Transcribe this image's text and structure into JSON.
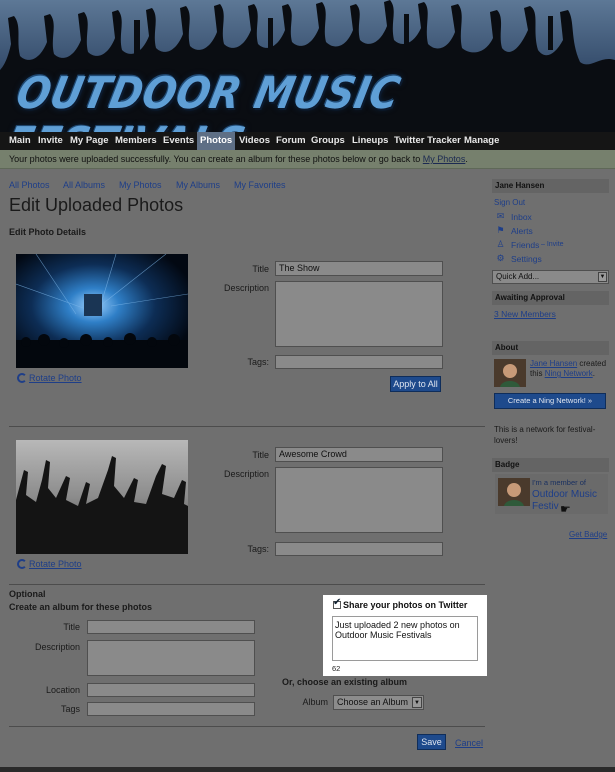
{
  "banner": {
    "title": "OUTDOOR MUSIC FESTIVALS"
  },
  "nav": {
    "items": [
      "Main",
      "Invite",
      "My Page",
      "Members",
      "Events",
      "Photos",
      "Videos",
      "Forum",
      "Groups",
      "Lineups",
      "Twitter Tracker",
      "Manage"
    ],
    "active": "Photos"
  },
  "notice": {
    "text": "Your photos were uploaded successfully. You can create an album for these photos below or go back to",
    "link": "My Photos",
    "end": "."
  },
  "tabs": [
    "All Photos",
    "All Albums",
    "My Photos",
    "My Albums",
    "My Favorites"
  ],
  "page_title": "Edit Uploaded Photos",
  "section_title": "Edit Photo Details",
  "photos": [
    {
      "title_label": "Title",
      "title_value": "The Show",
      "description_label": "Description",
      "tags_label": "Tags:",
      "rotate_label": "Rotate Photo"
    },
    {
      "title_label": "Title",
      "title_value": "Awesome Crowd",
      "description_label": "Description",
      "tags_label": "Tags:",
      "rotate_label": "Rotate Photo"
    }
  ],
  "apply_all": "Apply to All",
  "album": {
    "optional": "Optional",
    "heading": "Create an album for these photos",
    "title_label": "Title",
    "description_label": "Description",
    "location_label": "Location",
    "tags_label": "Tags",
    "existing_heading": "Or, choose an existing album",
    "album_label": "Album",
    "album_select": "Choose an Album"
  },
  "twitter": {
    "checkbox_label": "Share your photos on Twitter",
    "message_line1": "Just uploaded 2 new photos on",
    "message_line2": "Outdoor Music Festivals",
    "char_count": "62"
  },
  "actions": {
    "save": "Save",
    "cancel": "Cancel"
  },
  "sidebar": {
    "user_name": "Jane Hansen",
    "sign_out": "Sign Out",
    "inbox": "Inbox",
    "alerts": "Alerts",
    "friends": "Friends",
    "friends_invite": "– Invite",
    "settings": "Settings",
    "quick_add": "Quick Add...",
    "awaiting_head": "Awaiting Approval",
    "new_members": "3 New Members",
    "about_head": "About",
    "about_user": "Jane Hansen",
    "about_mid": "created",
    "about_this": "this",
    "about_network": "Ning Network",
    "about_end": ".",
    "create_network": "Create a Ning Network! »",
    "network_desc": "This is a network for festival-lovers!",
    "badge_head": "Badge",
    "badge_member": "I'm a member of",
    "badge_line1": "Outdoor Music",
    "badge_line2": "Festiv",
    "get_badge": "Get Badge"
  },
  "colors": {
    "nav_active": "#5e6f85",
    "button": "#1e4a8c",
    "link": "#1e3e88",
    "title_blue": "#5f9fd6"
  }
}
